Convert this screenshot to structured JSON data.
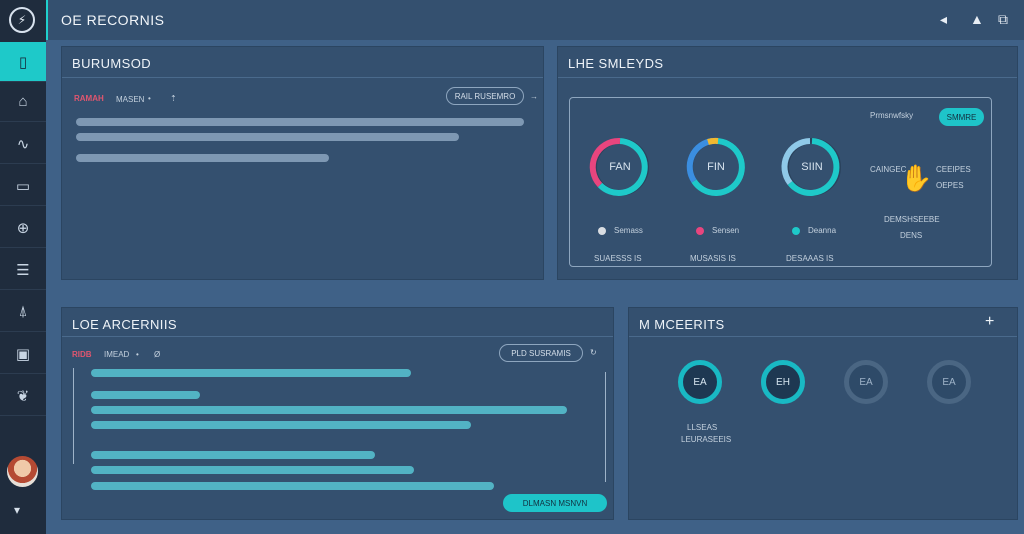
{
  "app": {
    "title": "OE RECORNIS"
  },
  "sidebar": {
    "items": [
      {
        "icon": "book-icon",
        "glyph": "▯"
      },
      {
        "icon": "home-icon",
        "glyph": "⌂"
      },
      {
        "icon": "wave-icon",
        "glyph": "∿"
      },
      {
        "icon": "folder-icon",
        "glyph": "▭"
      },
      {
        "icon": "globe-icon",
        "glyph": "⊕"
      },
      {
        "icon": "list-icon",
        "glyph": "☰"
      },
      {
        "icon": "tree-icon",
        "glyph": "⍋"
      },
      {
        "icon": "monitor-icon",
        "glyph": "▣"
      },
      {
        "icon": "brain-icon",
        "glyph": "❦"
      }
    ],
    "bottom_glyph": "▾"
  },
  "topbar_icons": [
    "◂",
    "▲",
    "⧉"
  ],
  "panel1": {
    "title": "BURUMSOD",
    "red_label": "RAMAH",
    "sub1": "MASEN",
    "sub2": "•",
    "sub3": "⇡",
    "button": "RAIL RUSEMRO",
    "button_arrow": "→"
  },
  "panel2": {
    "title": "LHE SMLEYDS",
    "cyan_button": "SMMRE",
    "side_text_1": "Prmsnwfsky",
    "side_text_2": "CAINGEC",
    "side_text_3": "CEEIPES",
    "side_text_4": "OEPES",
    "side_text_5": "DEMSHSEEBE",
    "side_text_6": "DENS",
    "gauges": [
      {
        "label": "FAN",
        "legend": "Semass",
        "value_label": "SUAESSS IS"
      },
      {
        "label": "FIN",
        "legend": "Sensen",
        "value_label": "MUSASIS IS"
      },
      {
        "label": "SIIN",
        "legend": "Deanna",
        "value_label": "DESAAAS IS"
      }
    ]
  },
  "panel3": {
    "title": "LOE ARCERNIIS",
    "red_label": "RIDB",
    "sub1": "IMEAD",
    "sub2": "•",
    "sub3": "Ø",
    "button": "PLD SUSRAMIS",
    "button_icon": "↻",
    "cyan_button": "DLMASN MSNVN"
  },
  "panel4": {
    "title": "M MCEERITS",
    "plus": "+",
    "metrics": [
      "EA",
      "EH",
      "EA",
      "EA"
    ],
    "caption_1": "LLSEAS",
    "caption_2": "LEURASEEIS"
  },
  "colors": {
    "accent": "#1ec9c9",
    "panel": "#34506f",
    "background": "#3f6187",
    "sidebar": "#1f2c3d"
  }
}
